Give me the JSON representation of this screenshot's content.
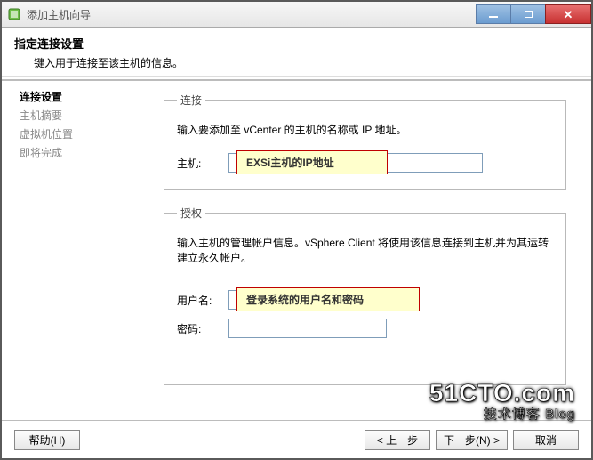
{
  "titlebar": {
    "title": "添加主机向导"
  },
  "header": {
    "heading": "指定连接设置",
    "subheading": "键入用于连接至该主机的信息。"
  },
  "sidebar": {
    "items": [
      {
        "label": "连接设置",
        "active": true
      },
      {
        "label": "主机摘要",
        "active": false
      },
      {
        "label": "虚拟机位置",
        "active": false
      },
      {
        "label": "即将完成",
        "active": false
      }
    ]
  },
  "connection": {
    "legend": "连接",
    "desc": "输入要添加至 vCenter 的主机的名称或 IP 地址。",
    "host_label": "主机:",
    "host_value": "",
    "callout": "EXSi主机的IP地址"
  },
  "auth": {
    "legend": "授权",
    "desc": "输入主机的管理帐户信息。vSphere Client 将使用该信息连接到主机并为其运转建立永久帐户。",
    "user_label": "用户名:",
    "user_value": "",
    "pass_label": "密码:",
    "pass_value": "",
    "callout": "登录系统的用户名和密码"
  },
  "footer": {
    "help": "帮助(H)",
    "back": "< 上一步",
    "next": "下一步(N) >",
    "cancel": "取消"
  },
  "watermark": {
    "line1": "51CTO.com",
    "line2": "技术博客 Blog"
  }
}
